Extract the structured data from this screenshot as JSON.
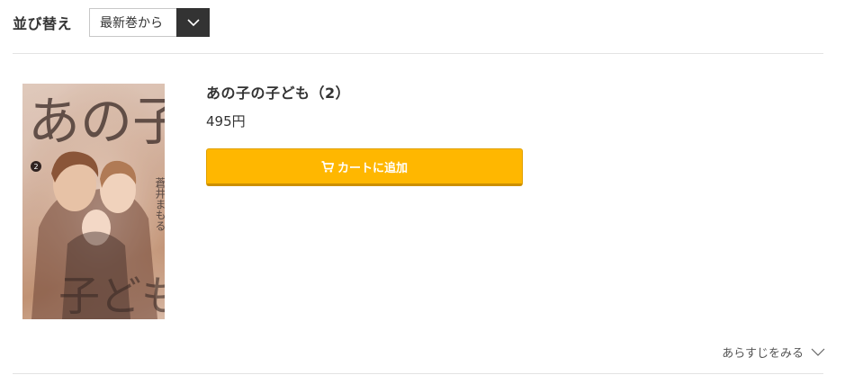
{
  "sort": {
    "label": "並び替え",
    "selected": "最新巻から",
    "toggle_icon": "chevron-down-icon"
  },
  "product": {
    "title": "あの子の子ども（2）",
    "price": "495円",
    "cart_button_label": "カートに追加",
    "cart_icon": "cart-icon",
    "cover": {
      "title_text": "あの子の子ども",
      "author_text": "蒼井まもる",
      "volume": "2"
    }
  },
  "synopsis": {
    "label": "あらすじをみる",
    "icon": "chevron-down-icon"
  },
  "colors": {
    "accent": "#ffb700",
    "dark": "#333333",
    "divider": "#e3e3e3"
  }
}
